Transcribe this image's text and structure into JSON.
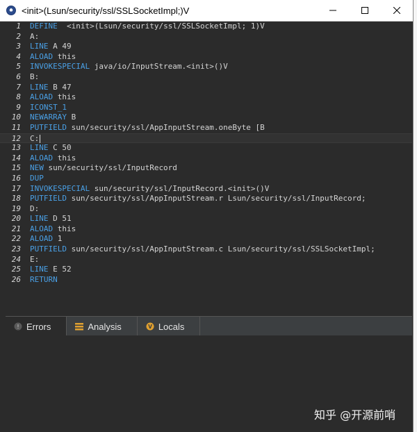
{
  "window": {
    "title": "<init>(Lsun/security/ssl/SSLSocketImpl;)V",
    "controls": [
      "minimize-icon",
      "maximize-icon",
      "close-icon"
    ]
  },
  "editor": {
    "current_line": 12,
    "lines": [
      {
        "no": "1",
        "parts": [
          [
            "kw",
            "DEFINE"
          ],
          [
            "txt",
            "  <init>(Lsun/security/ssl/SSLSocketImpl; 1)V"
          ]
        ]
      },
      {
        "no": "2",
        "parts": [
          [
            "txt",
            "A:"
          ]
        ]
      },
      {
        "no": "3",
        "parts": [
          [
            "kw",
            "LINE"
          ],
          [
            "txt",
            " A 49"
          ]
        ]
      },
      {
        "no": "4",
        "parts": [
          [
            "kw",
            "ALOAD"
          ],
          [
            "txt",
            " this"
          ]
        ]
      },
      {
        "no": "5",
        "parts": [
          [
            "kw",
            "INVOKESPECIAL"
          ],
          [
            "txt",
            " java/io/InputStream.<init>()V"
          ]
        ]
      },
      {
        "no": "6",
        "parts": [
          [
            "txt",
            "B:"
          ]
        ]
      },
      {
        "no": "7",
        "parts": [
          [
            "kw",
            "LINE"
          ],
          [
            "txt",
            " B 47"
          ]
        ]
      },
      {
        "no": "8",
        "parts": [
          [
            "kw",
            "ALOAD"
          ],
          [
            "txt",
            " this"
          ]
        ]
      },
      {
        "no": "9",
        "parts": [
          [
            "kw",
            "ICONST_1"
          ]
        ]
      },
      {
        "no": "10",
        "parts": [
          [
            "kw",
            "NEWARRAY"
          ],
          [
            "txt",
            " B"
          ]
        ]
      },
      {
        "no": "11",
        "parts": [
          [
            "kw",
            "PUTFIELD"
          ],
          [
            "txt",
            " sun/security/ssl/AppInputStream.oneByte [B"
          ]
        ]
      },
      {
        "no": "12",
        "parts": [
          [
            "txt",
            "C:"
          ]
        ]
      },
      {
        "no": "13",
        "parts": [
          [
            "kw",
            "LINE"
          ],
          [
            "txt",
            " C 50"
          ]
        ]
      },
      {
        "no": "14",
        "parts": [
          [
            "kw",
            "ALOAD"
          ],
          [
            "txt",
            " this"
          ]
        ]
      },
      {
        "no": "15",
        "parts": [
          [
            "kw",
            "NEW"
          ],
          [
            "txt",
            " sun/security/ssl/InputRecord"
          ]
        ]
      },
      {
        "no": "16",
        "parts": [
          [
            "kw",
            "DUP"
          ]
        ]
      },
      {
        "no": "17",
        "parts": [
          [
            "kw",
            "INVOKESPECIAL"
          ],
          [
            "txt",
            " sun/security/ssl/InputRecord.<init>()V"
          ]
        ]
      },
      {
        "no": "18",
        "parts": [
          [
            "kw",
            "PUTFIELD"
          ],
          [
            "txt",
            " sun/security/ssl/AppInputStream.r Lsun/security/ssl/InputRecord;"
          ]
        ]
      },
      {
        "no": "19",
        "parts": [
          [
            "txt",
            "D:"
          ]
        ]
      },
      {
        "no": "20",
        "parts": [
          [
            "kw",
            "LINE"
          ],
          [
            "txt",
            " D 51"
          ]
        ]
      },
      {
        "no": "21",
        "parts": [
          [
            "kw",
            "ALOAD"
          ],
          [
            "txt",
            " this"
          ]
        ]
      },
      {
        "no": "22",
        "parts": [
          [
            "kw",
            "ALOAD"
          ],
          [
            "txt",
            " 1"
          ]
        ]
      },
      {
        "no": "23",
        "parts": [
          [
            "kw",
            "PUTFIELD"
          ],
          [
            "txt",
            " sun/security/ssl/AppInputStream.c Lsun/security/ssl/SSLSocketImpl;"
          ]
        ]
      },
      {
        "no": "24",
        "parts": [
          [
            "txt",
            "E:"
          ]
        ]
      },
      {
        "no": "25",
        "parts": [
          [
            "kw",
            "LINE"
          ],
          [
            "txt",
            " E 52"
          ]
        ]
      },
      {
        "no": "26",
        "parts": [
          [
            "kw",
            "RETURN"
          ]
        ]
      }
    ]
  },
  "tabs": [
    {
      "label": "Errors",
      "icon": "error-icon",
      "active": true
    },
    {
      "label": "Analysis",
      "icon": "analysis-icon",
      "active": false
    },
    {
      "label": "Locals",
      "icon": "locals-icon",
      "active": false
    }
  ],
  "watermark": "知乎 @开源前哨",
  "colors": {
    "background": "#2b2b2b",
    "keyword": "#4aa0e6",
    "text": "#d4d4d4",
    "tab_bar": "#3c3f41"
  }
}
